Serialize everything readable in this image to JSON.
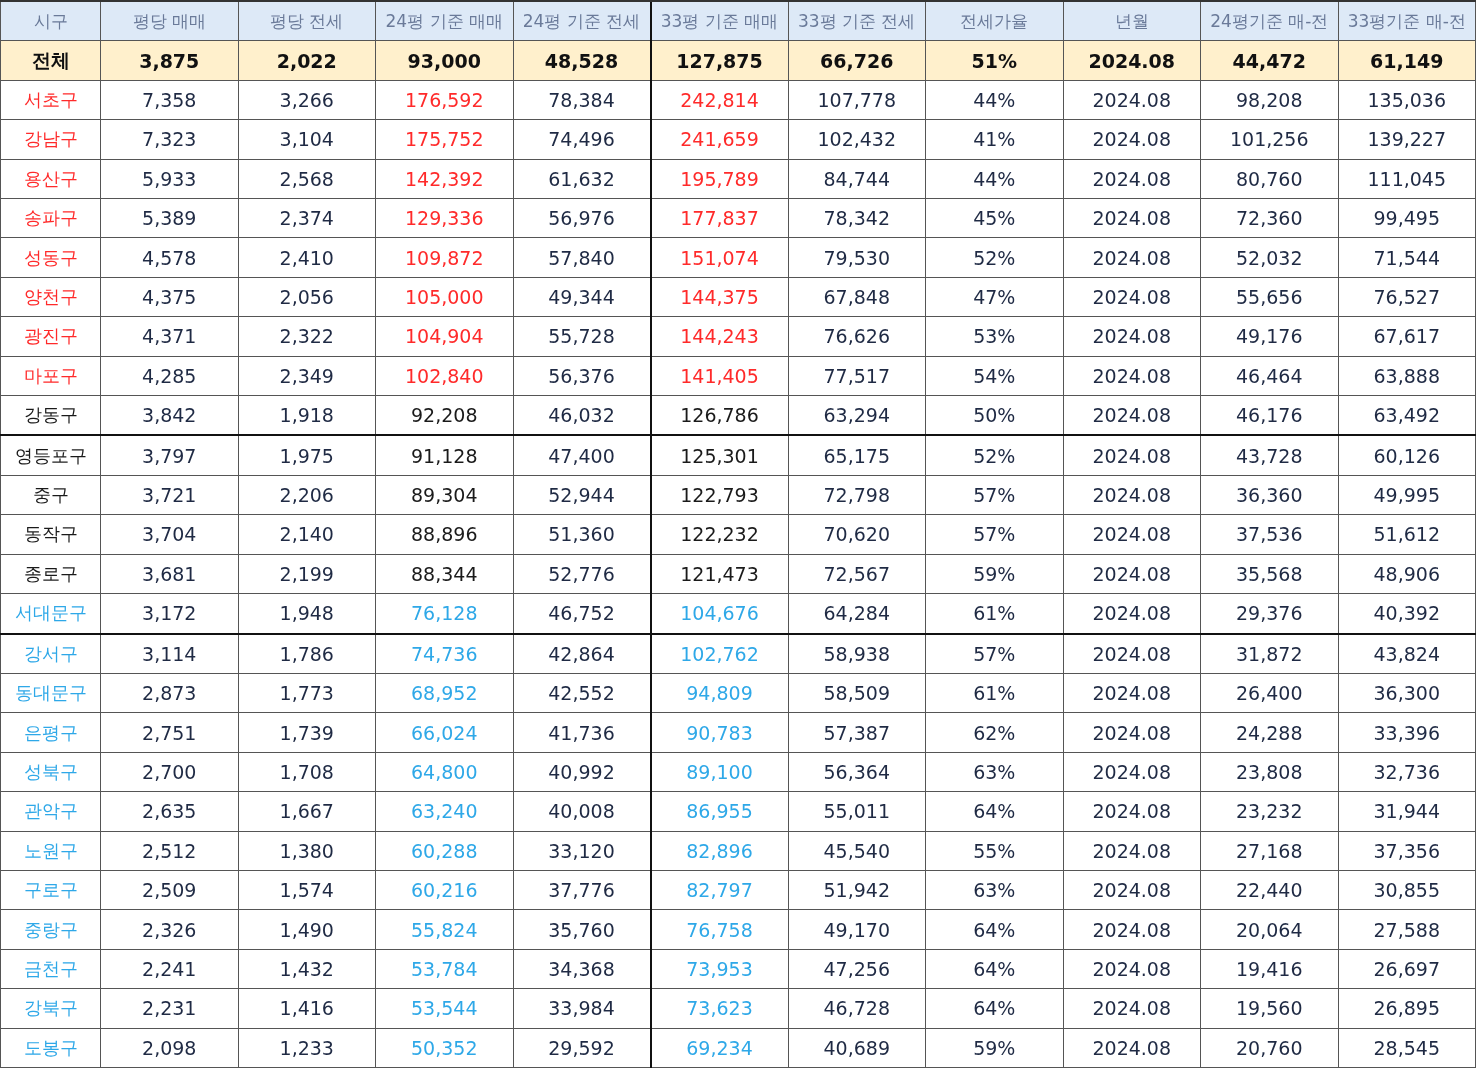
{
  "columns": [
    "시구",
    "평당 매매",
    "평당 전세",
    "24평 기준 매매",
    "24평 기준 전세",
    "33평 기준 매매",
    "33평 기준 전세",
    "전세가율",
    "년월",
    "24평기준 매-전",
    "33평기준 매-전"
  ],
  "total": {
    "name": "전체",
    "values": [
      "3,875",
      "2,022",
      "93,000",
      "48,528",
      "127,875",
      "66,726",
      "51%",
      "2024.08",
      "44,472",
      "61,149"
    ]
  },
  "rows": [
    {
      "name": "서초구",
      "color": "#ff2a2a",
      "rule_below": false,
      "values": [
        "7,358",
        "3,266",
        "176,592",
        "78,384",
        "242,814",
        "107,778",
        "44%",
        "2024.08",
        "98,208",
        "135,036"
      ]
    },
    {
      "name": "강남구",
      "color": "#ff2a2a",
      "rule_below": false,
      "values": [
        "7,323",
        "3,104",
        "175,752",
        "74,496",
        "241,659",
        "102,432",
        "41%",
        "2024.08",
        "101,256",
        "139,227"
      ]
    },
    {
      "name": "용산구",
      "color": "#ff2a2a",
      "rule_below": false,
      "values": [
        "5,933",
        "2,568",
        "142,392",
        "61,632",
        "195,789",
        "84,744",
        "44%",
        "2024.08",
        "80,760",
        "111,045"
      ]
    },
    {
      "name": "송파구",
      "color": "#ff2a2a",
      "rule_below": false,
      "values": [
        "5,389",
        "2,374",
        "129,336",
        "56,976",
        "177,837",
        "78,342",
        "45%",
        "2024.08",
        "72,360",
        "99,495"
      ]
    },
    {
      "name": "성동구",
      "color": "#ff2a2a",
      "rule_below": false,
      "values": [
        "4,578",
        "2,410",
        "109,872",
        "57,840",
        "151,074",
        "79,530",
        "52%",
        "2024.08",
        "52,032",
        "71,544"
      ]
    },
    {
      "name": "양천구",
      "color": "#ff2a2a",
      "rule_below": false,
      "values": [
        "4,375",
        "2,056",
        "105,000",
        "49,344",
        "144,375",
        "67,848",
        "47%",
        "2024.08",
        "55,656",
        "76,527"
      ]
    },
    {
      "name": "광진구",
      "color": "#ff2a2a",
      "rule_below": false,
      "values": [
        "4,371",
        "2,322",
        "104,904",
        "55,728",
        "144,243",
        "76,626",
        "53%",
        "2024.08",
        "49,176",
        "67,617"
      ]
    },
    {
      "name": "마포구",
      "color": "#ff2a2a",
      "rule_below": false,
      "values": [
        "4,285",
        "2,349",
        "102,840",
        "56,376",
        "141,405",
        "77,517",
        "54%",
        "2024.08",
        "46,464",
        "63,888"
      ]
    },
    {
      "name": "강동구",
      "color": "#1a1a1a",
      "rule_below": true,
      "values": [
        "3,842",
        "1,918",
        "92,208",
        "46,032",
        "126,786",
        "63,294",
        "50%",
        "2024.08",
        "46,176",
        "63,492"
      ]
    },
    {
      "name": "영등포구",
      "color": "#1a1a1a",
      "rule_below": false,
      "values": [
        "3,797",
        "1,975",
        "91,128",
        "47,400",
        "125,301",
        "65,175",
        "52%",
        "2024.08",
        "43,728",
        "60,126"
      ]
    },
    {
      "name": "중구",
      "color": "#1a1a1a",
      "rule_below": false,
      "values": [
        "3,721",
        "2,206",
        "89,304",
        "52,944",
        "122,793",
        "72,798",
        "57%",
        "2024.08",
        "36,360",
        "49,995"
      ]
    },
    {
      "name": "동작구",
      "color": "#1a1a1a",
      "rule_below": false,
      "values": [
        "3,704",
        "2,140",
        "88,896",
        "51,360",
        "122,232",
        "70,620",
        "57%",
        "2024.08",
        "37,536",
        "51,612"
      ]
    },
    {
      "name": "종로구",
      "color": "#1a1a1a",
      "rule_below": false,
      "values": [
        "3,681",
        "2,199",
        "88,344",
        "52,776",
        "121,473",
        "72,567",
        "59%",
        "2024.08",
        "35,568",
        "48,906"
      ]
    },
    {
      "name": "서대문구",
      "color": "#2ea8e8",
      "rule_below": true,
      "values": [
        "3,172",
        "1,948",
        "76,128",
        "46,752",
        "104,676",
        "64,284",
        "61%",
        "2024.08",
        "29,376",
        "40,392"
      ]
    },
    {
      "name": "강서구",
      "color": "#2ea8e8",
      "rule_below": false,
      "values": [
        "3,114",
        "1,786",
        "74,736",
        "42,864",
        "102,762",
        "58,938",
        "57%",
        "2024.08",
        "31,872",
        "43,824"
      ]
    },
    {
      "name": "동대문구",
      "color": "#2ea8e8",
      "rule_below": false,
      "values": [
        "2,873",
        "1,773",
        "68,952",
        "42,552",
        "94,809",
        "58,509",
        "61%",
        "2024.08",
        "26,400",
        "36,300"
      ]
    },
    {
      "name": "은평구",
      "color": "#2ea8e8",
      "rule_below": false,
      "values": [
        "2,751",
        "1,739",
        "66,024",
        "41,736",
        "90,783",
        "57,387",
        "62%",
        "2024.08",
        "24,288",
        "33,396"
      ]
    },
    {
      "name": "성북구",
      "color": "#2ea8e8",
      "rule_below": false,
      "values": [
        "2,700",
        "1,708",
        "64,800",
        "40,992",
        "89,100",
        "56,364",
        "63%",
        "2024.08",
        "23,808",
        "32,736"
      ]
    },
    {
      "name": "관악구",
      "color": "#2ea8e8",
      "rule_below": false,
      "values": [
        "2,635",
        "1,667",
        "63,240",
        "40,008",
        "86,955",
        "55,011",
        "64%",
        "2024.08",
        "23,232",
        "31,944"
      ]
    },
    {
      "name": "노원구",
      "color": "#2ea8e8",
      "rule_below": false,
      "values": [
        "2,512",
        "1,380",
        "60,288",
        "33,120",
        "82,896",
        "45,540",
        "55%",
        "2024.08",
        "27,168",
        "37,356"
      ]
    },
    {
      "name": "구로구",
      "color": "#2ea8e8",
      "rule_below": false,
      "values": [
        "2,509",
        "1,574",
        "60,216",
        "37,776",
        "82,797",
        "51,942",
        "63%",
        "2024.08",
        "22,440",
        "30,855"
      ]
    },
    {
      "name": "중랑구",
      "color": "#2ea8e8",
      "rule_below": false,
      "values": [
        "2,326",
        "1,490",
        "55,824",
        "35,760",
        "76,758",
        "49,170",
        "64%",
        "2024.08",
        "20,064",
        "27,588"
      ]
    },
    {
      "name": "금천구",
      "color": "#2ea8e8",
      "rule_below": false,
      "values": [
        "2,241",
        "1,432",
        "53,784",
        "34,368",
        "73,953",
        "47,256",
        "64%",
        "2024.08",
        "19,416",
        "26,697"
      ]
    },
    {
      "name": "강북구",
      "color": "#2ea8e8",
      "rule_below": false,
      "values": [
        "2,231",
        "1,416",
        "53,544",
        "33,984",
        "73,623",
        "46,728",
        "64%",
        "2024.08",
        "19,560",
        "26,895"
      ]
    },
    {
      "name": "도봉구",
      "color": "#2ea8e8",
      "rule_below": false,
      "values": [
        "2,098",
        "1,233",
        "50,352",
        "29,592",
        "69,234",
        "40,689",
        "59%",
        "2024.08",
        "20,760",
        "28,545"
      ]
    }
  ]
}
